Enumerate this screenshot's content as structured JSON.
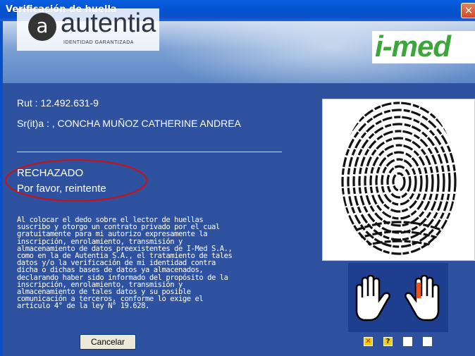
{
  "window": {
    "title": "Verificación de huella",
    "close_label": "✕"
  },
  "header": {
    "logo_letter": "a",
    "logo_name": "autentia",
    "logo_tagline": "IDENTIDAD GARANTIZADA",
    "partner_logo": "i-med"
  },
  "patient": {
    "rut": "Rut : 12.492.631-9",
    "name": "Sr(it)a : , CONCHA MUÑOZ CATHERINE ANDREA"
  },
  "status": {
    "line1": "RECHAZADO",
    "line2": "Por favor, reintente",
    "highlight_color": "#d01010"
  },
  "legal_text": "Al colocar el dedo sobre el lector de huellas\nsuscribo y otorgo un contrato privado por el cual\ngratuitamente para mi autorizo expresamente la\ninscripción, enrolamiento, transmisión y\nalmacenamiento de datos preexistentes de I-Med S.A.,\ncomo en la de Autentia S.A., el tratamiento de tales\ndatos y/o la verificación de mi identidad contra\ndicha o dichas bases de datos ya almacenados,\ndeclarando haber sido informado del propósito de la\ninscripción, enrolamiento, transmisión y\nalmacenamiento de tales datos y su posible\ncomunicación a terceros, conforme lo exige el\nartículo 4° de la ley N° 19.628.",
  "buttons": {
    "cancel": "Cancelar"
  },
  "finger_status": [
    {
      "icon": "x-mark-icon",
      "symbol": "✕",
      "bg": "#f5d000",
      "fg": "#d01010"
    },
    {
      "icon": "question-mark-icon",
      "symbol": "?",
      "bg": "#f5d000",
      "fg": "#1a1a1a"
    },
    {
      "icon": "empty-box",
      "symbol": "",
      "bg": "#ffffff",
      "fg": "#000000"
    },
    {
      "icon": "empty-box",
      "symbol": "",
      "bg": "#ffffff",
      "fg": "#000000"
    }
  ],
  "colors": {
    "panel_bg": "#2f52a0",
    "selected_finger": "#e8531f"
  }
}
